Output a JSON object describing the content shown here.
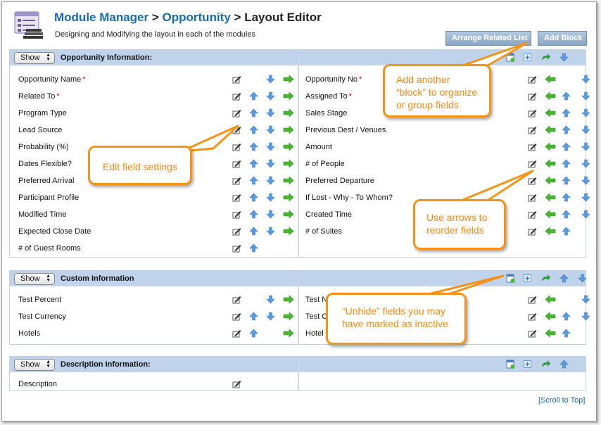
{
  "header": {
    "crumb_module_manager": "Module Manager",
    "sep1": ">",
    "crumb_opportunity": "Opportunity",
    "sep2": ">",
    "crumb_current": "Layout Editor",
    "subtitle": "Designing and Modifying the layout in each of the modules",
    "arrange_related_label": "Arrange Related List",
    "add_block_label": "Add Block"
  },
  "show_label": "Show",
  "blocks": [
    {
      "title": "Opportunity Information:",
      "left_fields": [
        {
          "label": "Opportunity Name",
          "required": "*",
          "icons": [
            "edit",
            "",
            "down",
            "right"
          ]
        },
        {
          "label": "Related To",
          "required": "*",
          "icons": [
            "edit",
            "up",
            "down",
            "right"
          ]
        },
        {
          "label": "Program Type",
          "required": "",
          "icons": [
            "edit",
            "up",
            "down",
            "right"
          ]
        },
        {
          "label": "Lead Source",
          "required": "",
          "icons": [
            "edit",
            "up",
            "down",
            "right"
          ]
        },
        {
          "label": "Probability (%)",
          "required": "",
          "icons": [
            "edit",
            "up",
            "down",
            "right"
          ]
        },
        {
          "label": "Dates Flexible?",
          "required": "",
          "icons": [
            "edit",
            "up",
            "down",
            "right"
          ]
        },
        {
          "label": "Preferred Arrival",
          "required": "",
          "icons": [
            "edit",
            "up",
            "down",
            "right"
          ]
        },
        {
          "label": "Participant Profile",
          "required": "",
          "icons": [
            "edit",
            "up",
            "down",
            "right"
          ]
        },
        {
          "label": "Modified Time",
          "required": "",
          "icons": [
            "edit",
            "up",
            "down",
            "right"
          ]
        },
        {
          "label": "Expected Close Date",
          "required": "",
          "icons": [
            "edit",
            "up",
            "down",
            "right"
          ]
        },
        {
          "label": "# of Guest Rooms",
          "required": "",
          "icons": [
            "edit",
            "up",
            "",
            ""
          ]
        }
      ],
      "right_fields": [
        {
          "label": "Opportunity No",
          "required": "*",
          "icons": [
            "edit",
            "left",
            "",
            "down"
          ]
        },
        {
          "label": "Assigned To",
          "required": "*",
          "icons": [
            "edit",
            "left",
            "up",
            "down"
          ]
        },
        {
          "label": "Sales Stage",
          "required": "",
          "icons": [
            "edit",
            "left",
            "up",
            "down"
          ]
        },
        {
          "label": "Previous Dest / Venues",
          "required": "",
          "icons": [
            "edit",
            "left",
            "up",
            "down"
          ]
        },
        {
          "label": "Amount",
          "required": "",
          "icons": [
            "edit",
            "left",
            "up",
            "down"
          ]
        },
        {
          "label": "# of People",
          "required": "",
          "icons": [
            "edit",
            "left",
            "up",
            "down"
          ]
        },
        {
          "label": "Preferred Departure",
          "required": "",
          "icons": [
            "edit",
            "left",
            "up",
            "down"
          ]
        },
        {
          "label": "If Lost - Why - To Whom?",
          "required": "",
          "icons": [
            "edit",
            "left",
            "up",
            "down"
          ]
        },
        {
          "label": "Created Time",
          "required": "",
          "icons": [
            "edit",
            "left",
            "up",
            "down"
          ]
        },
        {
          "label": "# of Suites",
          "required": "",
          "icons": [
            "edit",
            "left",
            "up",
            ""
          ]
        }
      ],
      "header_icons": [
        "add-field",
        "add",
        "undo",
        "down"
      ]
    },
    {
      "title": "Custom Information",
      "left_fields": [
        {
          "label": "Test Percent",
          "required": "",
          "icons": [
            "edit",
            "",
            "down",
            "right"
          ]
        },
        {
          "label": "Test Currency",
          "required": "",
          "icons": [
            "edit",
            "up",
            "down",
            "right"
          ]
        },
        {
          "label": "Hotels",
          "required": "",
          "icons": [
            "edit",
            "up",
            "",
            "right"
          ]
        }
      ],
      "right_fields": [
        {
          "label": "Test Nu",
          "required": "",
          "icons": [
            "edit",
            "left",
            "",
            "down"
          ]
        },
        {
          "label": "Test C",
          "required": "",
          "icons": [
            "edit",
            "left",
            "up",
            "down"
          ]
        },
        {
          "label": "Hotel S",
          "required": "",
          "icons": [
            "edit",
            "left",
            "up",
            ""
          ]
        }
      ],
      "header_icons": [
        "add-field",
        "add",
        "undo",
        "up",
        "down"
      ]
    },
    {
      "title": "Description Information:",
      "left_fields": [
        {
          "label": "Description",
          "required": "",
          "icons": [
            "edit",
            "",
            "",
            ""
          ]
        }
      ],
      "right_fields": [],
      "header_icons": [
        "add-field",
        "add",
        "undo",
        "up"
      ]
    }
  ],
  "callouts": {
    "add_block": [
      "Add another",
      "“block” to organize",
      "or group fields"
    ],
    "edit_field": [
      "Edit field settings"
    ],
    "reorder": [
      "Use arrows to",
      "reorder fields"
    ],
    "unhide": [
      "“Unhide” fields you may",
      "have marked as inactive"
    ]
  },
  "scroll_to_top": "[Scroll to Top]",
  "colors": {
    "link_blue": "#1a6aa8",
    "block_header": "#c1d3ea",
    "callout_orange": "#f39419",
    "required_red": "#d00000",
    "arrow_blue": "#5b9be0",
    "arrow_green": "#46b82e"
  }
}
